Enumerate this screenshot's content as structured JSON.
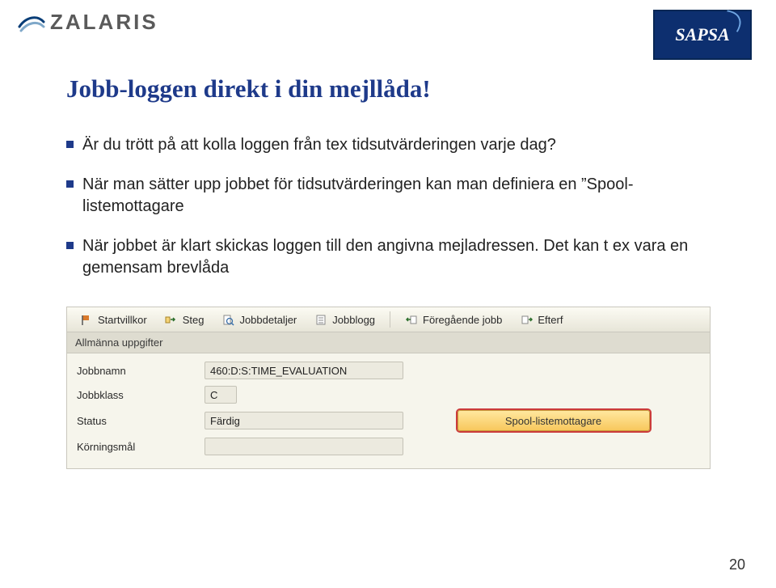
{
  "header": {
    "zalaris": "ZALARIS",
    "sapsa": "SAPSA"
  },
  "title": "Jobb-loggen direkt i din mejllåda!",
  "bullets": [
    "Är du trött på att kolla loggen från tex tidsutvärderingen varje dag?",
    "När man sätter upp jobbet för tidsutvärderingen kan man definiera en ”Spool-listemottagare",
    "När jobbet är klart skickas loggen till den angivna mejladressen. Det kan t ex vara en gemensam brevlåda"
  ],
  "sap": {
    "toolbar": {
      "start": "Startvillkor",
      "step": "Steg",
      "detail": "Jobbdetaljer",
      "log": "Jobblogg",
      "prev": "Föregående jobb",
      "next": "Efterf"
    },
    "section_header": "Allmänna uppgifter",
    "labels": {
      "jobname": "Jobbnamn",
      "jobclass": "Jobbklass",
      "status": "Status",
      "target": "Körningsmål"
    },
    "values": {
      "jobname": "460:D:S:TIME_EVALUATION",
      "jobclass": "C",
      "status": "Färdig",
      "target": ""
    },
    "spool_button": "Spool-listemottagare"
  },
  "page_number": "20"
}
